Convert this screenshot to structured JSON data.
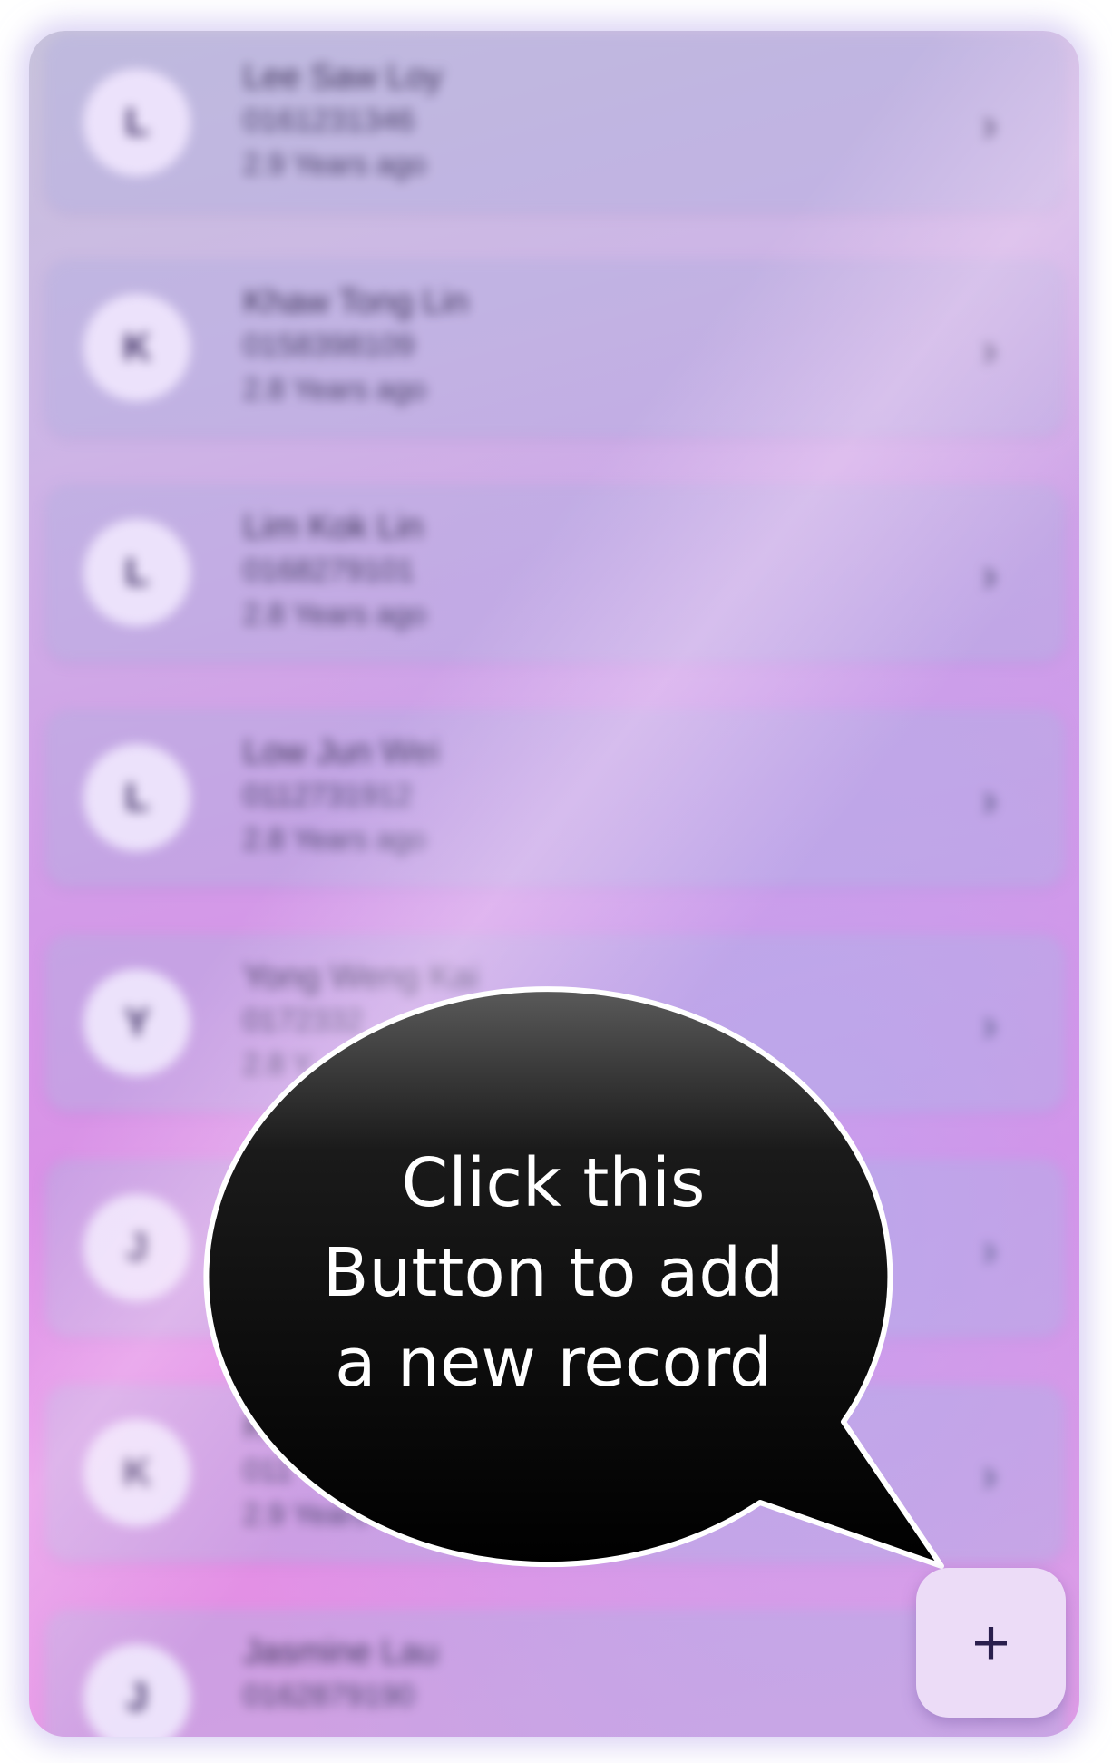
{
  "contacts": [
    {
      "initial": "L",
      "name": "Lee Saw Loy",
      "phone": "0161231346",
      "time": "2.9 Years ago"
    },
    {
      "initial": "K",
      "name": "Khaw Tong Lin",
      "phone": "0158398109",
      "time": "2.8 Years ago"
    },
    {
      "initial": "L",
      "name": "Lim Kok Lin",
      "phone": "0168279101",
      "time": "2.8 Years ago"
    },
    {
      "initial": "L",
      "name": "Low Jun Wei",
      "phone": "0112731912",
      "time": "2.8 Years ago"
    },
    {
      "initial": "Y",
      "name": "Yong Weng Kai",
      "phone": "0172332",
      "time": "2.8 Y"
    },
    {
      "initial": "J",
      "name": "",
      "phone": "",
      "time": ""
    },
    {
      "initial": "K",
      "name": "K",
      "phone": "011",
      "time": "2.9 Years"
    },
    {
      "initial": "J",
      "name": "Jasmine Lau",
      "phone": "0162879190",
      "time": ""
    }
  ],
  "chevron_glyph": "›",
  "callout": {
    "lines": [
      "Click this",
      "Button to add",
      "a new record"
    ]
  },
  "fab": {
    "glyph": "+",
    "icon": "plus-icon"
  }
}
